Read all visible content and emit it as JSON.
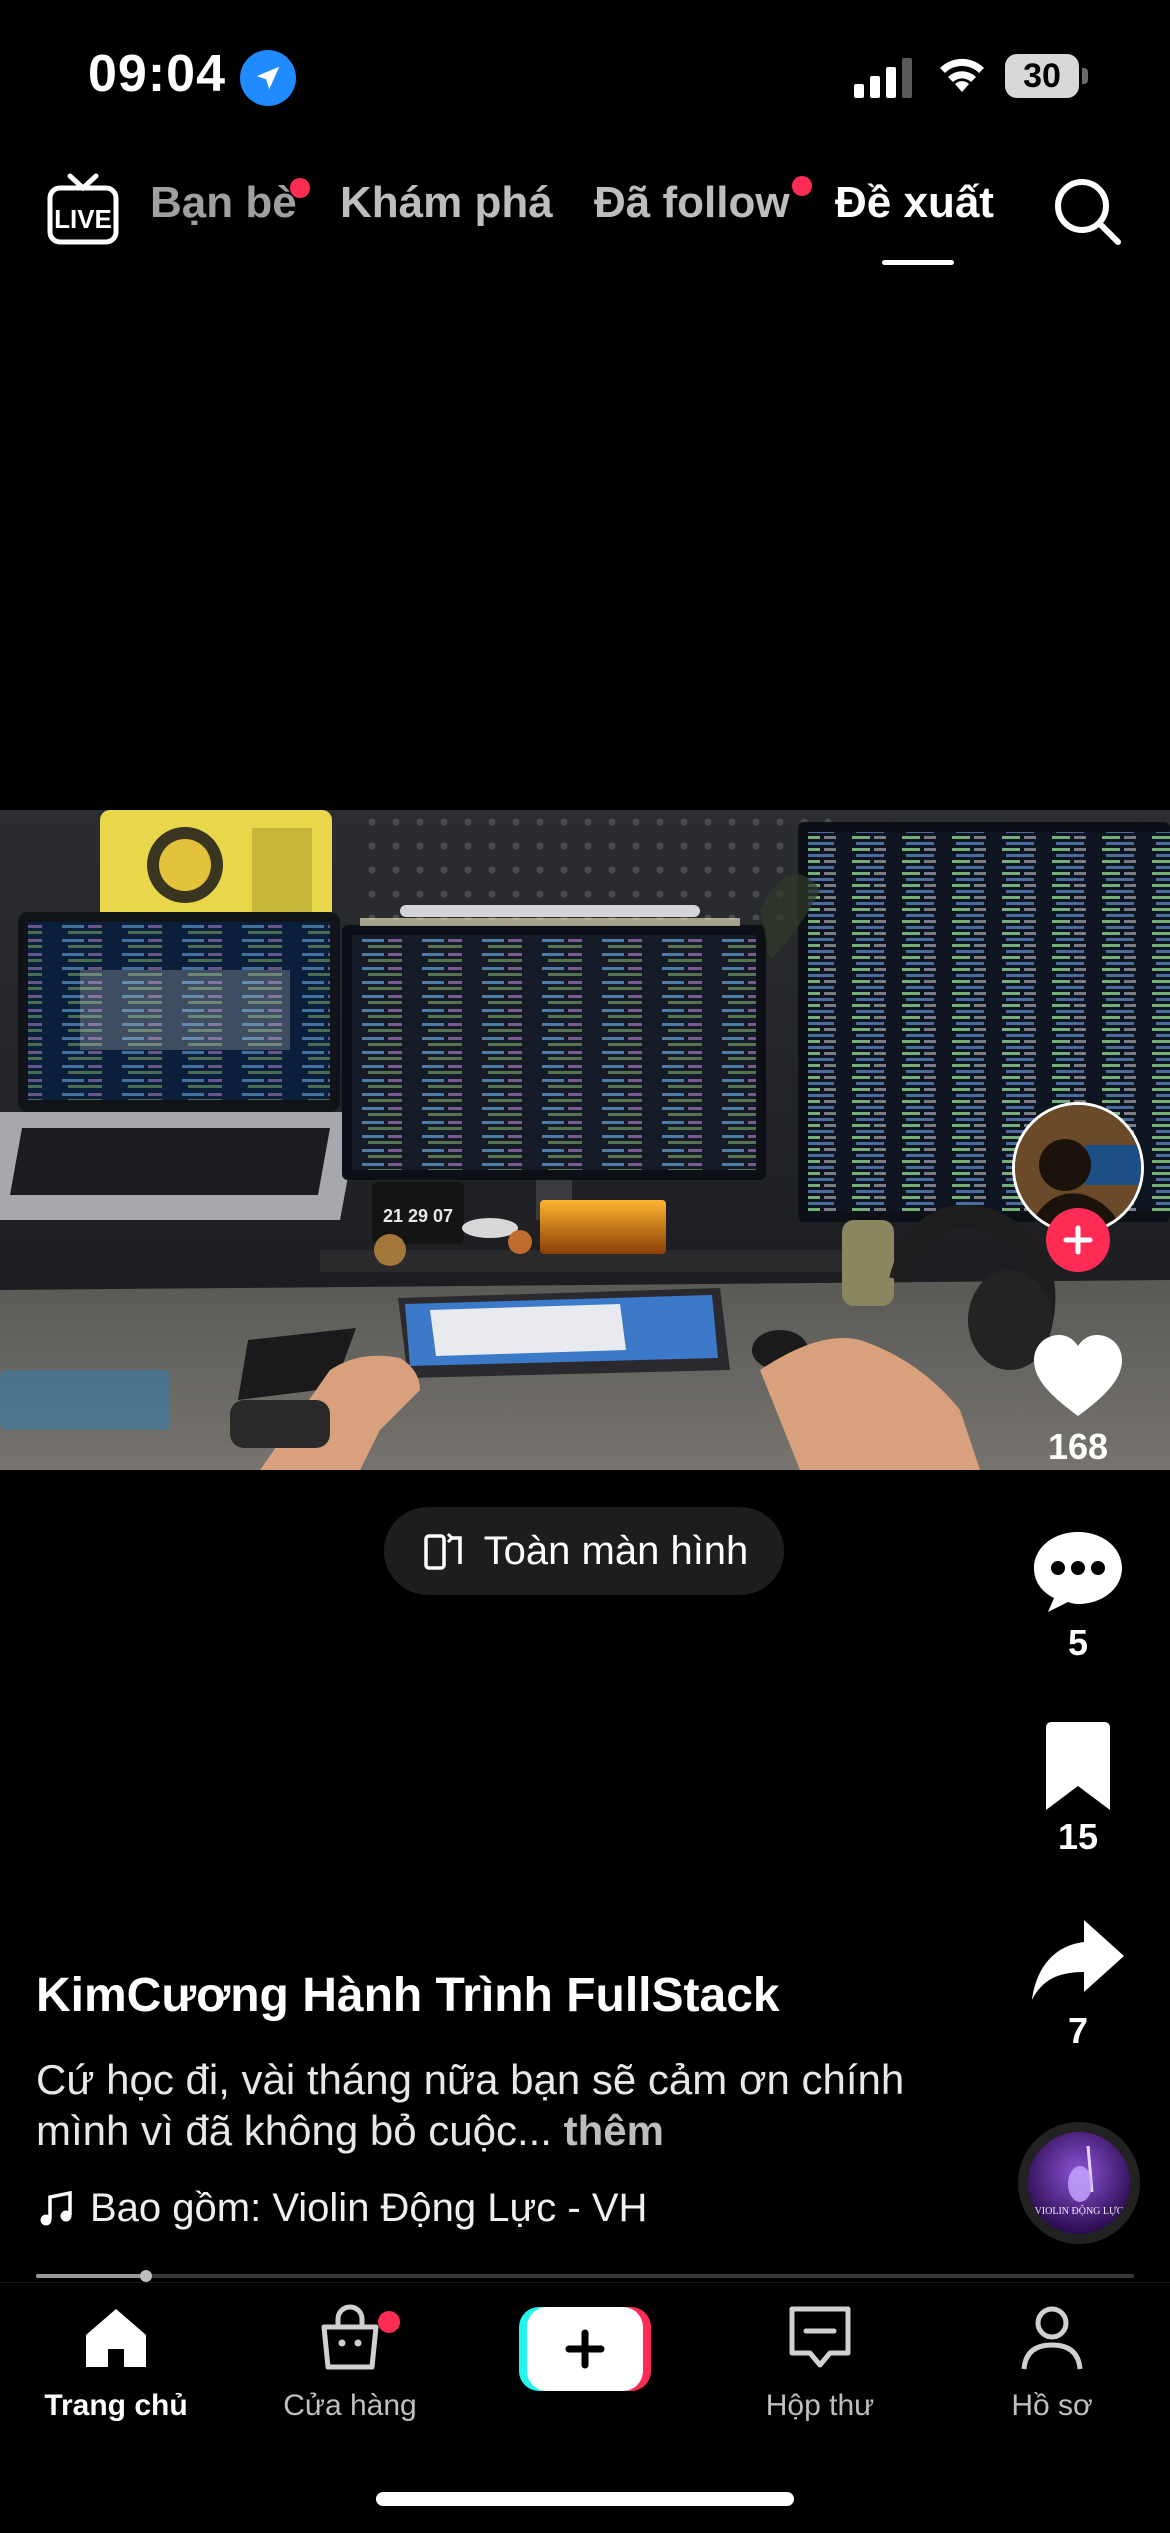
{
  "status_bar": {
    "time": "09:04",
    "battery": "30"
  },
  "top_nav": {
    "live_label": "LIVE",
    "tabs": [
      {
        "label": "Bạn bè",
        "has_dot": true
      },
      {
        "label": "Khám phá",
        "has_dot": false
      },
      {
        "label": "Đã follow",
        "has_dot": true
      },
      {
        "label": "Đề xuất",
        "active": true
      }
    ]
  },
  "video": {
    "clock_display": "21 29 07",
    "fullscreen_label": "Toàn màn hình"
  },
  "right_rail": {
    "likes": "168",
    "comments": "5",
    "saves": "15",
    "shares": "7",
    "disc_text": "VIOLIN ĐỘNG LỰC"
  },
  "post": {
    "username": "KimCương Hành Trình FullStack",
    "caption": "Cứ học đi, vài tháng nữa bạn sẽ cảm ơn chính mình vì đã không bỏ cuộc...",
    "more_label": "thêm",
    "music": "Bao gồm: Violin Động Lực - VH",
    "progress_fraction": 0.1
  },
  "bottom_nav": {
    "items": [
      {
        "label": "Trang chủ",
        "active": true
      },
      {
        "label": "Cửa hàng"
      },
      {
        "label": "Hộp thư"
      },
      {
        "label": "Hồ sơ"
      }
    ]
  },
  "colors": {
    "accent": "#fe2c55",
    "location": "#1f8bff",
    "cyan": "#25f4ee"
  }
}
